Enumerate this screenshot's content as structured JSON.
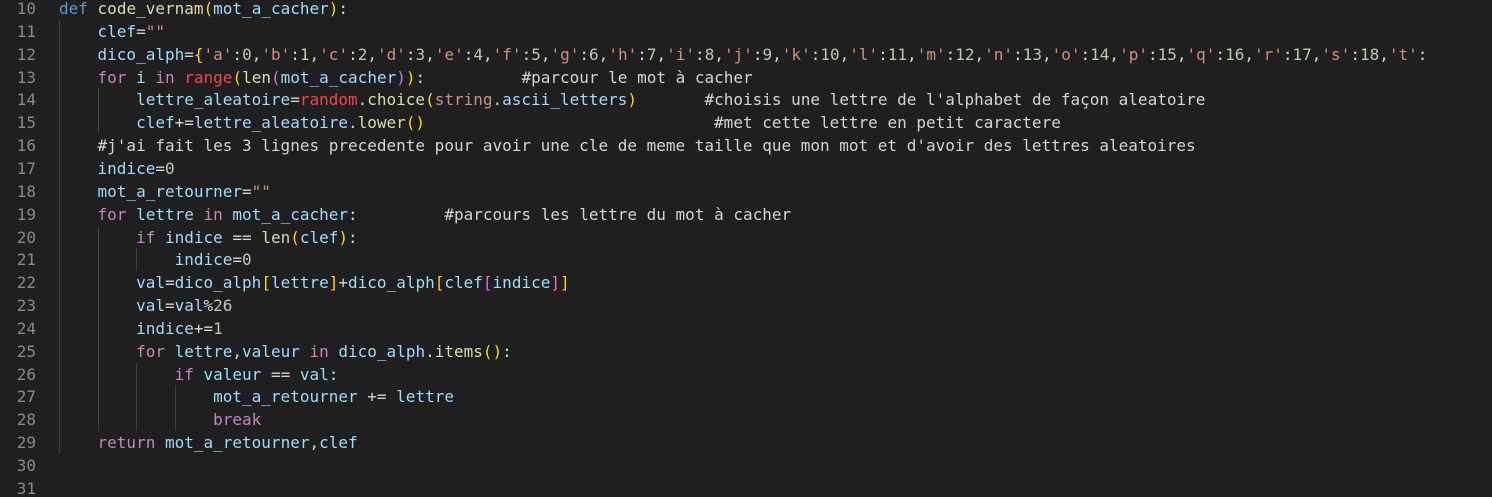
{
  "colors": {
    "background": "#1f1f1f",
    "line_number": "#8a8a8a",
    "indent_guide": "#404040",
    "keyword_control": "#c586c0",
    "keyword": "#569cd6",
    "function": "#dcdcaa",
    "variable": "#9cdcfe",
    "string": "#ce9178",
    "number": "#b5cea8",
    "builtin": "#f44747",
    "bracket_1": "#ffd700",
    "bracket_2": "#da70d6",
    "bracket_3": "#179fff"
  },
  "lines": [
    {
      "num": "10",
      "indent": 0,
      "tokens": [
        [
          "kw",
          "def"
        ],
        [
          "plain",
          " "
        ],
        [
          "fn",
          "code_vernam"
        ],
        [
          "b1",
          "("
        ],
        [
          "var",
          "mot_a_cacher"
        ],
        [
          "b1",
          ")"
        ],
        [
          "plain",
          ":"
        ]
      ]
    },
    {
      "num": "11",
      "indent": 1,
      "tokens": [
        [
          "var",
          "clef"
        ],
        [
          "op",
          "="
        ],
        [
          "str",
          "\"\""
        ]
      ]
    },
    {
      "num": "12",
      "indent": 1,
      "tokens": [
        [
          "var",
          "dico_alph"
        ],
        [
          "op",
          "="
        ],
        [
          "b1",
          "{"
        ],
        [
          "str",
          "'a'"
        ],
        [
          "plain",
          ":"
        ],
        [
          "num",
          "0"
        ],
        [
          "plain",
          ","
        ],
        [
          "str",
          "'b'"
        ],
        [
          "plain",
          ":"
        ],
        [
          "num",
          "1"
        ],
        [
          "plain",
          ","
        ],
        [
          "str",
          "'c'"
        ],
        [
          "plain",
          ":"
        ],
        [
          "num",
          "2"
        ],
        [
          "plain",
          ","
        ],
        [
          "str",
          "'d'"
        ],
        [
          "plain",
          ":"
        ],
        [
          "num",
          "3"
        ],
        [
          "plain",
          ","
        ],
        [
          "str",
          "'e'"
        ],
        [
          "plain",
          ":"
        ],
        [
          "num",
          "4"
        ],
        [
          "plain",
          ","
        ],
        [
          "str",
          "'f'"
        ],
        [
          "plain",
          ":"
        ],
        [
          "num",
          "5"
        ],
        [
          "plain",
          ","
        ],
        [
          "str",
          "'g'"
        ],
        [
          "plain",
          ":"
        ],
        [
          "num",
          "6"
        ],
        [
          "plain",
          ","
        ],
        [
          "str",
          "'h'"
        ],
        [
          "plain",
          ":"
        ],
        [
          "num",
          "7"
        ],
        [
          "plain",
          ","
        ],
        [
          "str",
          "'i'"
        ],
        [
          "plain",
          ":"
        ],
        [
          "num",
          "8"
        ],
        [
          "plain",
          ","
        ],
        [
          "str",
          "'j'"
        ],
        [
          "plain",
          ":"
        ],
        [
          "num",
          "9"
        ],
        [
          "plain",
          ","
        ],
        [
          "str",
          "'k'"
        ],
        [
          "plain",
          ":"
        ],
        [
          "num",
          "10"
        ],
        [
          "plain",
          ","
        ],
        [
          "str",
          "'l'"
        ],
        [
          "plain",
          ":"
        ],
        [
          "num",
          "11"
        ],
        [
          "plain",
          ","
        ],
        [
          "str",
          "'m'"
        ],
        [
          "plain",
          ":"
        ],
        [
          "num",
          "12"
        ],
        [
          "plain",
          ","
        ],
        [
          "str",
          "'n'"
        ],
        [
          "plain",
          ":"
        ],
        [
          "num",
          "13"
        ],
        [
          "plain",
          ","
        ],
        [
          "str",
          "'o'"
        ],
        [
          "plain",
          ":"
        ],
        [
          "num",
          "14"
        ],
        [
          "plain",
          ","
        ],
        [
          "str",
          "'p'"
        ],
        [
          "plain",
          ":"
        ],
        [
          "num",
          "15"
        ],
        [
          "plain",
          ","
        ],
        [
          "str",
          "'q'"
        ],
        [
          "plain",
          ":"
        ],
        [
          "num",
          "16"
        ],
        [
          "plain",
          ","
        ],
        [
          "str",
          "'r'"
        ],
        [
          "plain",
          ":"
        ],
        [
          "num",
          "17"
        ],
        [
          "plain",
          ","
        ],
        [
          "str",
          "'s'"
        ],
        [
          "plain",
          ":"
        ],
        [
          "num",
          "18"
        ],
        [
          "plain",
          ","
        ],
        [
          "str",
          "'t'"
        ],
        [
          "plain",
          ":"
        ]
      ]
    },
    {
      "num": "13",
      "indent": 1,
      "tokens": [
        [
          "kw-ctrl",
          "for"
        ],
        [
          "plain",
          " "
        ],
        [
          "var",
          "i"
        ],
        [
          "plain",
          " "
        ],
        [
          "kw-ctrl",
          "in"
        ],
        [
          "plain",
          " "
        ],
        [
          "bi",
          "range"
        ],
        [
          "b1",
          "("
        ],
        [
          "fn",
          "len"
        ],
        [
          "b2",
          "("
        ],
        [
          "var",
          "mot_a_cacher"
        ],
        [
          "b2",
          ")"
        ],
        [
          "b1",
          ")"
        ],
        [
          "plain",
          ":"
        ],
        [
          "plain",
          "          "
        ],
        [
          "cmt",
          "#parcour le mot à cacher"
        ]
      ]
    },
    {
      "num": "14",
      "indent": 2,
      "tokens": [
        [
          "var",
          "lettre_aleatoire"
        ],
        [
          "op",
          "="
        ],
        [
          "bi",
          "random"
        ],
        [
          "plain",
          "."
        ],
        [
          "fn",
          "choice"
        ],
        [
          "b1",
          "("
        ],
        [
          "mod",
          "string"
        ],
        [
          "plain",
          "."
        ],
        [
          "var",
          "ascii_letters"
        ],
        [
          "b1",
          ")"
        ],
        [
          "plain",
          "       "
        ],
        [
          "cmt",
          "#choisis une lettre de l'alphabet de façon aleatoire"
        ]
      ]
    },
    {
      "num": "15",
      "indent": 2,
      "tokens": [
        [
          "var",
          "clef"
        ],
        [
          "op",
          "+="
        ],
        [
          "var",
          "lettre_aleatoire"
        ],
        [
          "plain",
          "."
        ],
        [
          "fn",
          "lower"
        ],
        [
          "b1",
          "()"
        ],
        [
          "plain",
          "                              "
        ],
        [
          "cmt",
          "#met cette lettre en petit caractere"
        ]
      ]
    },
    {
      "num": "16",
      "indent": 1,
      "tokens": [
        [
          "cmt",
          "#j'ai fait les 3 lignes precedente pour avoir une cle de meme taille que mon mot et d'avoir des lettres aleatoires"
        ]
      ]
    },
    {
      "num": "17",
      "indent": 1,
      "tokens": [
        [
          "var",
          "indice"
        ],
        [
          "op",
          "="
        ],
        [
          "num",
          "0"
        ]
      ]
    },
    {
      "num": "18",
      "indent": 1,
      "tokens": [
        [
          "var",
          "mot_a_retourner"
        ],
        [
          "op",
          "="
        ],
        [
          "str",
          "\"\""
        ]
      ]
    },
    {
      "num": "19",
      "indent": 1,
      "tokens": [
        [
          "kw-ctrl",
          "for"
        ],
        [
          "plain",
          " "
        ],
        [
          "var",
          "lettre"
        ],
        [
          "plain",
          " "
        ],
        [
          "kw-ctrl",
          "in"
        ],
        [
          "plain",
          " "
        ],
        [
          "var",
          "mot_a_cacher"
        ],
        [
          "plain",
          ":"
        ],
        [
          "plain",
          "         "
        ],
        [
          "cmt",
          "#parcours les lettre du mot à cacher"
        ]
      ]
    },
    {
      "num": "20",
      "indent": 2,
      "tokens": [
        [
          "kw-ctrl",
          "if"
        ],
        [
          "plain",
          " "
        ],
        [
          "var",
          "indice"
        ],
        [
          "plain",
          " "
        ],
        [
          "op",
          "=="
        ],
        [
          "plain",
          " "
        ],
        [
          "fn",
          "len"
        ],
        [
          "b1",
          "("
        ],
        [
          "var",
          "clef"
        ],
        [
          "b1",
          ")"
        ],
        [
          "plain",
          ":"
        ]
      ]
    },
    {
      "num": "21",
      "indent": 3,
      "tokens": [
        [
          "var",
          "indice"
        ],
        [
          "op",
          "="
        ],
        [
          "num",
          "0"
        ]
      ]
    },
    {
      "num": "22",
      "indent": 2,
      "tokens": [
        [
          "var",
          "val"
        ],
        [
          "op",
          "="
        ],
        [
          "var",
          "dico_alph"
        ],
        [
          "b1",
          "["
        ],
        [
          "var",
          "lettre"
        ],
        [
          "b1",
          "]"
        ],
        [
          "op",
          "+"
        ],
        [
          "var",
          "dico_alph"
        ],
        [
          "b1",
          "["
        ],
        [
          "var",
          "clef"
        ],
        [
          "b2",
          "["
        ],
        [
          "var",
          "indice"
        ],
        [
          "b2",
          "]"
        ],
        [
          "b1",
          "]"
        ]
      ]
    },
    {
      "num": "23",
      "indent": 2,
      "tokens": [
        [
          "var",
          "val"
        ],
        [
          "op",
          "="
        ],
        [
          "var",
          "val"
        ],
        [
          "op",
          "%"
        ],
        [
          "num",
          "26"
        ]
      ]
    },
    {
      "num": "24",
      "indent": 2,
      "tokens": [
        [
          "var",
          "indice"
        ],
        [
          "op",
          "+="
        ],
        [
          "num",
          "1"
        ]
      ]
    },
    {
      "num": "25",
      "indent": 2,
      "tokens": [
        [
          "kw-ctrl",
          "for"
        ],
        [
          "plain",
          " "
        ],
        [
          "var",
          "lettre"
        ],
        [
          "plain",
          ","
        ],
        [
          "var",
          "valeur"
        ],
        [
          "plain",
          " "
        ],
        [
          "kw-ctrl",
          "in"
        ],
        [
          "plain",
          " "
        ],
        [
          "var",
          "dico_alph"
        ],
        [
          "plain",
          "."
        ],
        [
          "fn",
          "items"
        ],
        [
          "b1",
          "()"
        ],
        [
          "plain",
          ":"
        ]
      ]
    },
    {
      "num": "26",
      "indent": 3,
      "tokens": [
        [
          "kw-ctrl",
          "if"
        ],
        [
          "plain",
          " "
        ],
        [
          "var",
          "valeur"
        ],
        [
          "plain",
          " "
        ],
        [
          "op",
          "=="
        ],
        [
          "plain",
          " "
        ],
        [
          "var",
          "val"
        ],
        [
          "plain",
          ":"
        ]
      ]
    },
    {
      "num": "27",
      "indent": 4,
      "tokens": [
        [
          "var",
          "mot_a_retourner"
        ],
        [
          "plain",
          " "
        ],
        [
          "op",
          "+="
        ],
        [
          "plain",
          " "
        ],
        [
          "var",
          "lettre"
        ]
      ]
    },
    {
      "num": "28",
      "indent": 4,
      "tokens": [
        [
          "kw-ctrl",
          "break"
        ]
      ]
    },
    {
      "num": "29",
      "indent": 1,
      "tokens": [
        [
          "kw-ctrl",
          "return"
        ],
        [
          "plain",
          " "
        ],
        [
          "var",
          "mot_a_retourner"
        ],
        [
          "plain",
          ","
        ],
        [
          "var",
          "clef"
        ]
      ]
    },
    {
      "num": "30",
      "indent": 0,
      "tokens": []
    },
    {
      "num": "31",
      "indent": 0,
      "tokens": []
    }
  ]
}
